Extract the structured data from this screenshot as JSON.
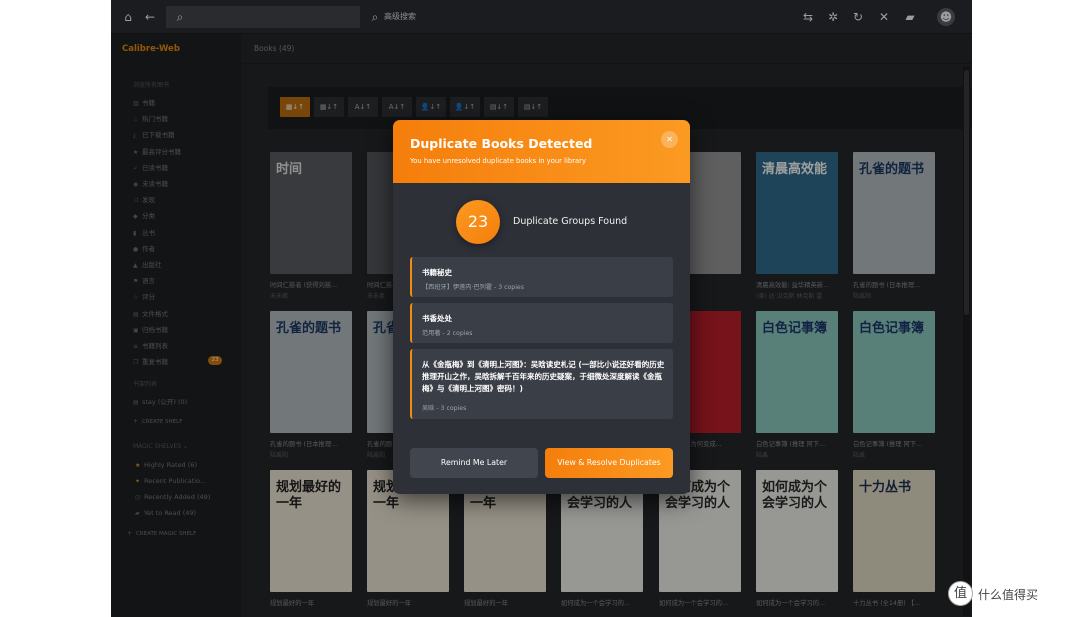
{
  "topbar": {
    "advanced_search_label": "高级搜索"
  },
  "sidebar": {
    "brand": "Calibre-Web",
    "browse_header": "浏览所有图书",
    "items": [
      {
        "icon": "books-icon",
        "label": "书籍"
      },
      {
        "icon": "fire-icon",
        "label": "热门书籍"
      },
      {
        "icon": "download-icon",
        "label": "已下载书籍"
      },
      {
        "icon": "star-icon",
        "label": "最高评分书籍"
      },
      {
        "icon": "check-icon",
        "label": "已读书籍"
      },
      {
        "icon": "eye-icon",
        "label": "未读书籍"
      },
      {
        "icon": "random-icon",
        "label": "发现"
      },
      {
        "icon": "tag-icon",
        "label": "分类"
      },
      {
        "icon": "bookmark-icon",
        "label": "丛书"
      },
      {
        "icon": "user-icon",
        "label": "作者"
      },
      {
        "icon": "publisher-icon",
        "label": "出版社"
      },
      {
        "icon": "flag-icon",
        "label": "语言"
      },
      {
        "icon": "rating-icon",
        "label": "评分"
      },
      {
        "icon": "file-icon",
        "label": "文件格式"
      },
      {
        "icon": "archive-icon",
        "label": "归档书籍"
      },
      {
        "icon": "list-icon",
        "label": "书籍列表"
      },
      {
        "icon": "duplicate-icon",
        "label": "重复书籍",
        "badge": "23"
      }
    ],
    "shelves_header": "书架列表",
    "shelves": [
      {
        "label": "stay (公开)",
        "count": "(0)"
      }
    ],
    "create_shelf": "CREATE SHELF",
    "magic_header": "MAGIC SHELVES",
    "magic_shelves": [
      {
        "label": "Highly Rated",
        "count": "(6)"
      },
      {
        "label": "Recent Publicatio...",
        "count": ""
      },
      {
        "label": "Recently Added",
        "count": "(49)"
      },
      {
        "label": "Yet to Read",
        "count": "(49)"
      }
    ],
    "create_magic_shelf": "CREATE MAGIC SHELF"
  },
  "main": {
    "books_title": "Books (49)",
    "sort_buttons": [
      "▦↓↑",
      "▦↓↑",
      "A↓↑",
      "A↓↑",
      "👤↓↑",
      "👤↓↑",
      "▤↓↑",
      "▤↓↑"
    ],
    "books": [
      {
        "title": "时间仁慈者 (获得刘慈...",
        "author": "未未君",
        "cover_text": "时间"
      },
      {
        "title": "时间仁慈者 (获得刘...",
        "author": "未未君",
        "cover_text": ""
      },
      {
        "title": "",
        "author": "",
        "cover_text": ""
      },
      {
        "title": "",
        "author": "",
        "cover_text": ""
      },
      {
        "title": "",
        "author": "",
        "cover_text": ""
      },
      {
        "title": "清晨高效能: 益华精英新...",
        "author": "(美) 达·汉克斯 林克斯 雷",
        "cover_text": "清晨高效能"
      },
      {
        "title": "孔雀的题书 (日本推理...",
        "author": "陆禹阳",
        "cover_text": "孔雀的题书"
      },
      {
        "title": "孔雀的题书 (日本推理...",
        "author": "陆禹阳",
        "cover_text": "孔雀的题书"
      },
      {
        "title": "孔雀的题书 (日本推...",
        "author": "陆禹阳",
        "cover_text": "孔雀的题书"
      },
      {
        "title": "",
        "author": "",
        "cover_text": ""
      },
      {
        "title": "",
        "author": "",
        "cover_text": ""
      },
      {
        "title": "如何成为人为何变成...",
        "author": "",
        "cover_text": "人"
      },
      {
        "title": "白色记事簿 (推理 阿下...",
        "author": "陆禹",
        "cover_text": "白色记事簿"
      },
      {
        "title": "白色记事簿 (推理 阿下...",
        "author": "陆禹",
        "cover_text": "白色记事簿"
      },
      {
        "title": "规划最好的一年",
        "author": "",
        "cover_text": "规划最好的一年"
      },
      {
        "title": "规划最好的一年",
        "author": "",
        "cover_text": "规划最好的一年"
      },
      {
        "title": "规划最好的一年",
        "author": "",
        "cover_text": "规划最好的一年"
      },
      {
        "title": "如何成为一个会学习的...",
        "author": "",
        "cover_text": "如何成为个会学习的人"
      },
      {
        "title": "如何成为一个会学习的...",
        "author": "",
        "cover_text": "如何成为个会学习的人"
      },
      {
        "title": "如何成为一个会学习的...",
        "author": "",
        "cover_text": "如何成为个会学习的人"
      },
      {
        "title": "十力丛书 (全14册) 【...",
        "author": "",
        "cover_text": "十力丛书"
      }
    ]
  },
  "modal": {
    "title": "Duplicate Books Detected",
    "subtitle": "You have unresolved duplicate books in your library",
    "count": "23",
    "count_label": "Duplicate Groups Found",
    "groups": [
      {
        "title": "书籍秘史",
        "meta": "【西班牙】伊莲内·巴列霍 - 3 copies"
      },
      {
        "title": "书香处处",
        "meta": "范用著 - 2 copies"
      },
      {
        "title": "从《金瓶梅》到《清明上河图》：吴晗读史札记 (一部比小说还好看的历史推理开山之作，吴晗拆解千百年来的历史疑案，于细微处深度解读《金瓶梅》与《清明上河图》密码！)",
        "meta": "吴晗 - 3 copies"
      }
    ],
    "remind_label": "Remind Me Later",
    "resolve_label": "View & Resolve Duplicates"
  },
  "watermark": {
    "logo": "值",
    "text": "什么值得买"
  }
}
